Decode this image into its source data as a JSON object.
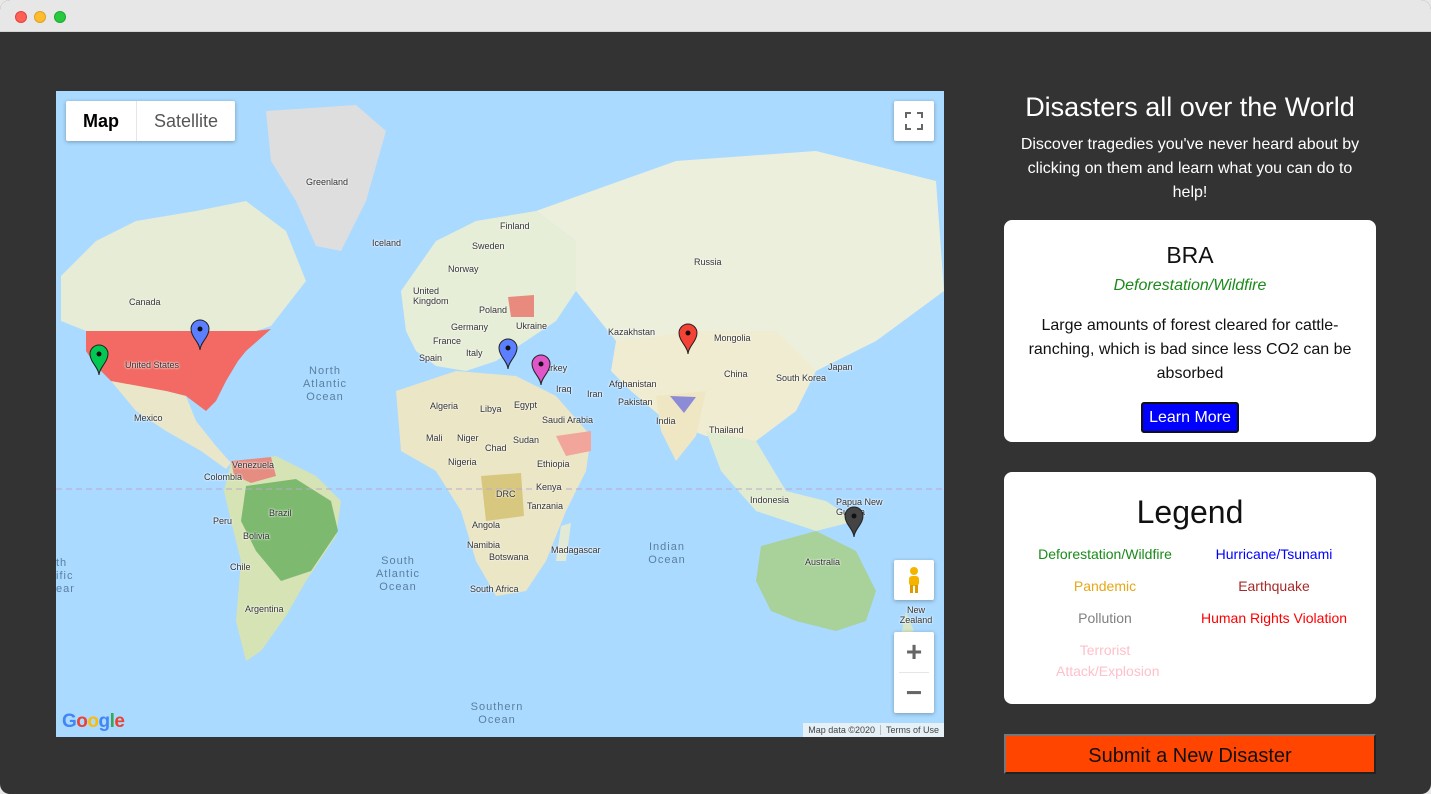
{
  "map": {
    "type_buttons": [
      "Map",
      "Satellite"
    ],
    "active_type": "Map",
    "labels": {
      "greenland": "Greenland",
      "iceland": "Iceland",
      "finland": "Finland",
      "sweden": "Sweden",
      "norway": "Norway",
      "russia": "Russia",
      "united_kingdom": "United Kingdom",
      "poland": "Poland",
      "germany": "Germany",
      "ukraine": "Ukraine",
      "france": "France",
      "spain": "Spain",
      "italy": "Italy",
      "turkey": "Turkey",
      "kazakhstan": "Kazakhstan",
      "mongolia": "Mongolia",
      "china": "China",
      "south_korea": "South Korea",
      "japan": "Japan",
      "iraq": "Iraq",
      "iran": "Iran",
      "afghanistan": "Afghanistan",
      "pakistan": "Pakistan",
      "india": "India",
      "thailand": "Thailand",
      "indonesia": "Indonesia",
      "papua_new_guinea": "Papua New Guinea",
      "australia": "Australia",
      "new_zealand": "New Zealand",
      "canada": "Canada",
      "united_states": "United States",
      "mexico": "Mexico",
      "venezuela": "Venezuela",
      "colombia": "Colombia",
      "peru": "Peru",
      "brazil": "Brazil",
      "bolivia": "Bolivia",
      "chile": "Chile",
      "argentina": "Argentina",
      "algeria": "Algeria",
      "libya": "Libya",
      "egypt": "Egypt",
      "saudi_arabia": "Saudi Arabia",
      "mali": "Mali",
      "niger": "Niger",
      "chad": "Chad",
      "sudan": "Sudan",
      "nigeria": "Nigeria",
      "ethiopia": "Ethiopia",
      "drc": "DRC",
      "kenya": "Kenya",
      "tanzania": "Tanzania",
      "angola": "Angola",
      "namibia": "Namibia",
      "botswana": "Botswana",
      "madagascar": "Madagascar",
      "south_africa": "South Africa"
    },
    "oceans": {
      "north_atlantic": "North Atlantic Ocean",
      "south_atlantic": "South Atlantic Ocean",
      "indian": "Indian Ocean",
      "southern": "Southern Ocean",
      "partial": "th ific ean"
    },
    "logo": "Google",
    "attribution": [
      "Map data ©2020",
      "Terms of Use"
    ],
    "marker_colors": {
      "green": "#00c853",
      "blue": "#5b7fff",
      "red": "#f44336",
      "pink": "#e056c8",
      "black": "#444444"
    }
  },
  "panel": {
    "title": "Disasters all over the World",
    "intro": "Discover tragedies you've never heard about by clicking on them and learn what you can do to help!"
  },
  "info_card": {
    "code": "BRA",
    "category": "Deforestation/Wildfire",
    "description": "Large amounts of forest cleared for cattle-ranching, which is bad since less CO2 can be absorbed",
    "button": "Learn More"
  },
  "legend": {
    "title": "Legend",
    "items": [
      {
        "label": "Deforestation/Wildfire",
        "color": "#1a8a1a"
      },
      {
        "label": "Hurricane/Tsunami",
        "color": "#0000ff"
      },
      {
        "label": "Pandemic",
        "color": "#e6a817"
      },
      {
        "label": "Earthquake",
        "color": "#a52a2a"
      },
      {
        "label": "Pollution",
        "color": "#808080"
      },
      {
        "label": "Human Rights Violation",
        "color": "#ff0000"
      },
      {
        "label": "Terrorist Attack/Explosion",
        "color": "#ffc0cb"
      }
    ]
  },
  "submit_button": "Submit a New Disaster"
}
